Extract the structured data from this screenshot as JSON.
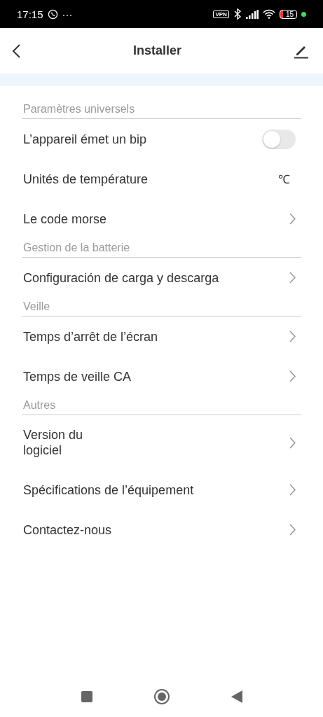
{
  "status_bar": {
    "time": "17:15",
    "more": "···",
    "vpn": "VPN",
    "battery": "15"
  },
  "header": {
    "title": "Installer"
  },
  "sections": [
    {
      "title": "Paramètres universels",
      "items": [
        {
          "kind": "toggle",
          "label": "L’appareil émet un bip",
          "on": false
        },
        {
          "kind": "value",
          "label": "Unités de température",
          "value": "℃"
        },
        {
          "kind": "link",
          "label": "Le code morse"
        }
      ]
    },
    {
      "title": "Gestion de la batterie",
      "items": [
        {
          "kind": "link",
          "label": "Configuración de carga y descarga"
        }
      ]
    },
    {
      "title": "Veille",
      "items": [
        {
          "kind": "link",
          "label": "Temps d’arrêt de l’écran"
        },
        {
          "kind": "link",
          "label": "Temps de veille CA"
        }
      ]
    },
    {
      "title": "Autres",
      "items": [
        {
          "kind": "link",
          "label": "Version du logiciel",
          "narrow": true
        },
        {
          "kind": "link",
          "label": "Spécifications de l’équipement"
        },
        {
          "kind": "link",
          "label": "Contactez-nous"
        }
      ]
    }
  ]
}
